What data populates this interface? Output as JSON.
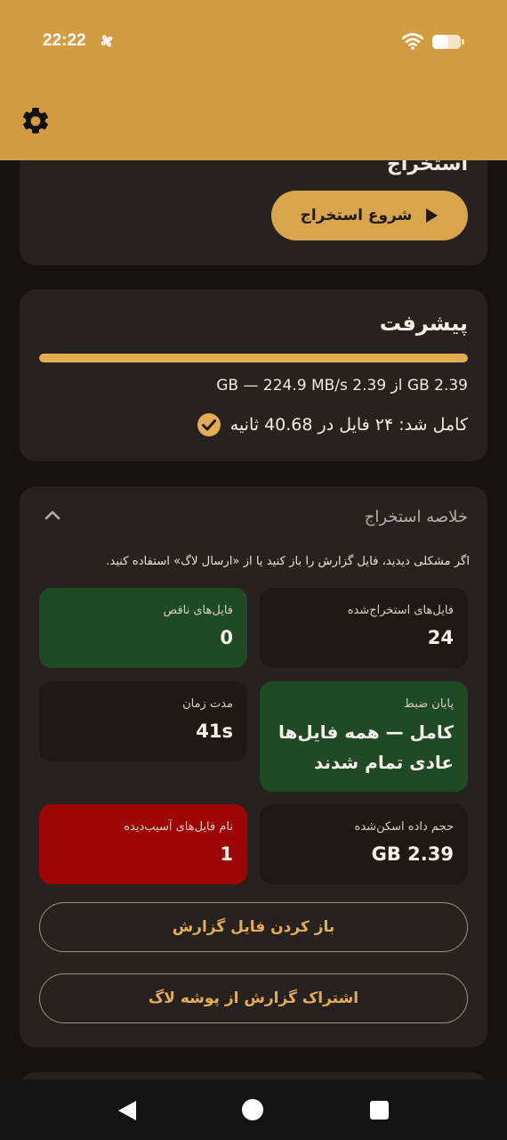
{
  "status_bar": {
    "time": "22:22"
  },
  "extract_card": {
    "title": "استخراج",
    "start_button": "شروع استخراج"
  },
  "progress_card": {
    "title": "پیشرفت",
    "progress_fraction": 1.0,
    "stats": "2.39 GB از 2.39 GB — 224.9 MB/s",
    "done_text": "کامل شد: ۲۴ فایل در 40.68 ثانیه"
  },
  "summary_card": {
    "title": "خلاصه استخراج",
    "hint": "اگر مشکلی دیدید، فایل گزارش را باز کنید یا از «ارسال لاگ» استفاده کنید.",
    "tiles": [
      {
        "label": "فایل‌های استخراج‌شده",
        "value": "24"
      },
      {
        "label": "فایل‌های ناقص",
        "value": "0"
      },
      {
        "label": "پایان ضبط",
        "value": "کامل — همه فایل‌ها عادی تمام شدند"
      },
      {
        "label": "مدت زمان",
        "value": "41s"
      },
      {
        "label": "حجم داده اسکن‌شده",
        "value": "2.39 GB"
      },
      {
        "label": "نام فایل‌های آسیب‌دیده",
        "value": "1"
      }
    ],
    "open_report_button": "باز کردن فایل گزارش",
    "share_log_button": "اشتراک گزارش از پوشه لاگ"
  },
  "colors": {
    "accent": "#d49c40",
    "card_bg": "#272220",
    "tile_green": "#1f4a24",
    "tile_red": "#9e0606"
  }
}
